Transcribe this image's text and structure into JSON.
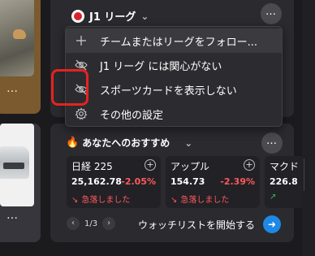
{
  "left_cards": {
    "top_more": "…",
    "bottom_more": "…"
  },
  "sports_card": {
    "league_title": "J1 リーグ",
    "more_label": "…"
  },
  "context_menu": {
    "items": [
      {
        "label": "チームまたはリーグをフォロー...",
        "icon": "plus-icon"
      },
      {
        "label": "J1 リーグ には関心がない",
        "icon": "eye-off-icon"
      },
      {
        "label": "スポーツカードを表示しない",
        "icon": "eye-off-icon"
      },
      {
        "label": "その他の設定",
        "icon": "gear-icon"
      }
    ]
  },
  "recommendations": {
    "title": "あなたへのおすすめ",
    "more_label": "…",
    "stocks": [
      {
        "name": "日経 225",
        "price": "25,162.78",
        "change": "-2.05%",
        "trend": "急落しました"
      },
      {
        "name": "アップル",
        "price": "154.73",
        "change": "-2.39%",
        "trend": "急落しました"
      },
      {
        "name": "マクド",
        "price": "226.8",
        "change": "",
        "trend": ""
      }
    ],
    "page": "1/3",
    "watchlist_label": "ウォッチリストを開始する"
  },
  "colors": {
    "highlight": "#e5231f",
    "negative": "#ff5a5a",
    "positive": "#2fbf5b",
    "accent": "#1e88e5"
  }
}
